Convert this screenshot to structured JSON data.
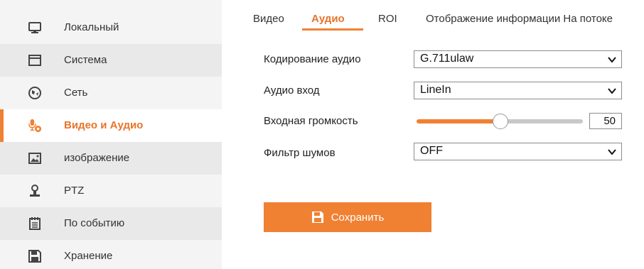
{
  "sidebar": {
    "items": [
      {
        "label": "Локальный",
        "icon": "monitor-icon"
      },
      {
        "label": "Система",
        "icon": "window-icon"
      },
      {
        "label": "Сеть",
        "icon": "globe-icon"
      },
      {
        "label": "Видео и Аудио",
        "icon": "microphone-camera-icon",
        "active": true
      },
      {
        "label": "изображение",
        "icon": "image-icon"
      },
      {
        "label": "PTZ",
        "icon": "ptz-icon"
      },
      {
        "label": "По событию",
        "icon": "calendar-icon"
      },
      {
        "label": "Хранение",
        "icon": "floppy-icon"
      }
    ]
  },
  "tabs": [
    {
      "label": "Видео"
    },
    {
      "label": "Аудио",
      "active": true
    },
    {
      "label": "ROI"
    },
    {
      "label": "Отображение информации На потоке"
    }
  ],
  "form": {
    "audio_encoding": {
      "label": "Кодирование аудио",
      "value": "G.711ulaw"
    },
    "audio_input": {
      "label": "Аудио вход",
      "value": "LineIn"
    },
    "input_volume": {
      "label": "Входная громкость",
      "value": "50"
    },
    "noise_filter": {
      "label": "Фильтр шумов",
      "value": "OFF"
    }
  },
  "save_button": {
    "label": "Сохранить"
  },
  "colors": {
    "accent": "#f08133",
    "sidebar_bg": "#f4f4f4",
    "text": "#333333"
  }
}
